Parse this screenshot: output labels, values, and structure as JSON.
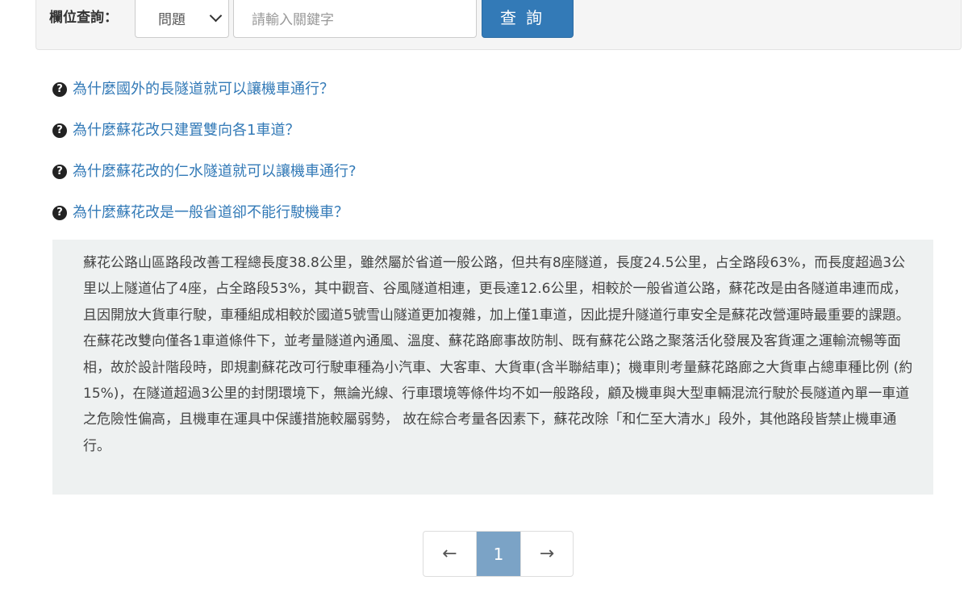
{
  "search": {
    "label": "欄位查詢：",
    "field_select_value": "問題",
    "keyword_placeholder": "請輸入關鍵字",
    "button_label": "查詢"
  },
  "faq": {
    "questions": [
      "為什麼國外的長隧道就可以讓機車通行？",
      "為什麼蘇花改只建置雙向各1車道？",
      "為什麼蘇花改的仁水隧道就可以讓機車通行?",
      "為什麼蘇花改是一般省道卻不能行駛機車？"
    ],
    "answer": {
      "paragraph1": "蘇花公路山區路段改善工程總長度38.8公里，雖然屬於省道一般公路，但共有8座隧道，長度24.5公里，占全路段63%，而長度超過3公里以上隧道佔了4座，占全路段53%，其中觀音、谷風隧道相連，更長達12.6公里，相較於一般省道公路，蘇花改是由各隧道串連而成，且因開放大貨車行駛，車種組成相較於國道5號雪山隧道更加複雜，加上僅1車道，因此提升隧道行車安全是蘇花改營運時最重要的課題。",
      "paragraph2": "在蘇花改雙向僅各1車道條件下，並考量隧道內通風、溫度、蘇花路廊事故防制、既有蘇花公路之聚落活化發展及客貨運之運輸流暢等面相，故於設計階段時，即規劃蘇花改可行駛車種為小汽車、大客車、大貨車(含半聯結車)；機車則考量蘇花路廊之大貨車占總車種比例 (約15%)，在隧道超過3公里的封閉環境下，無論光線、行車環境等條件均不如一般路段，顧及機車與大型車輛混流行駛於長隧道內單一車道之危險性偏高，且機車在運具中保護措施較屬弱勢， 故在綜合考量各因素下，蘇花改除「和仁至大清水」段外，其他路段皆禁止機車通行。"
    }
  },
  "pagination": {
    "prev": "←",
    "current": "1",
    "next": "→"
  },
  "icons": {
    "question": "?"
  }
}
